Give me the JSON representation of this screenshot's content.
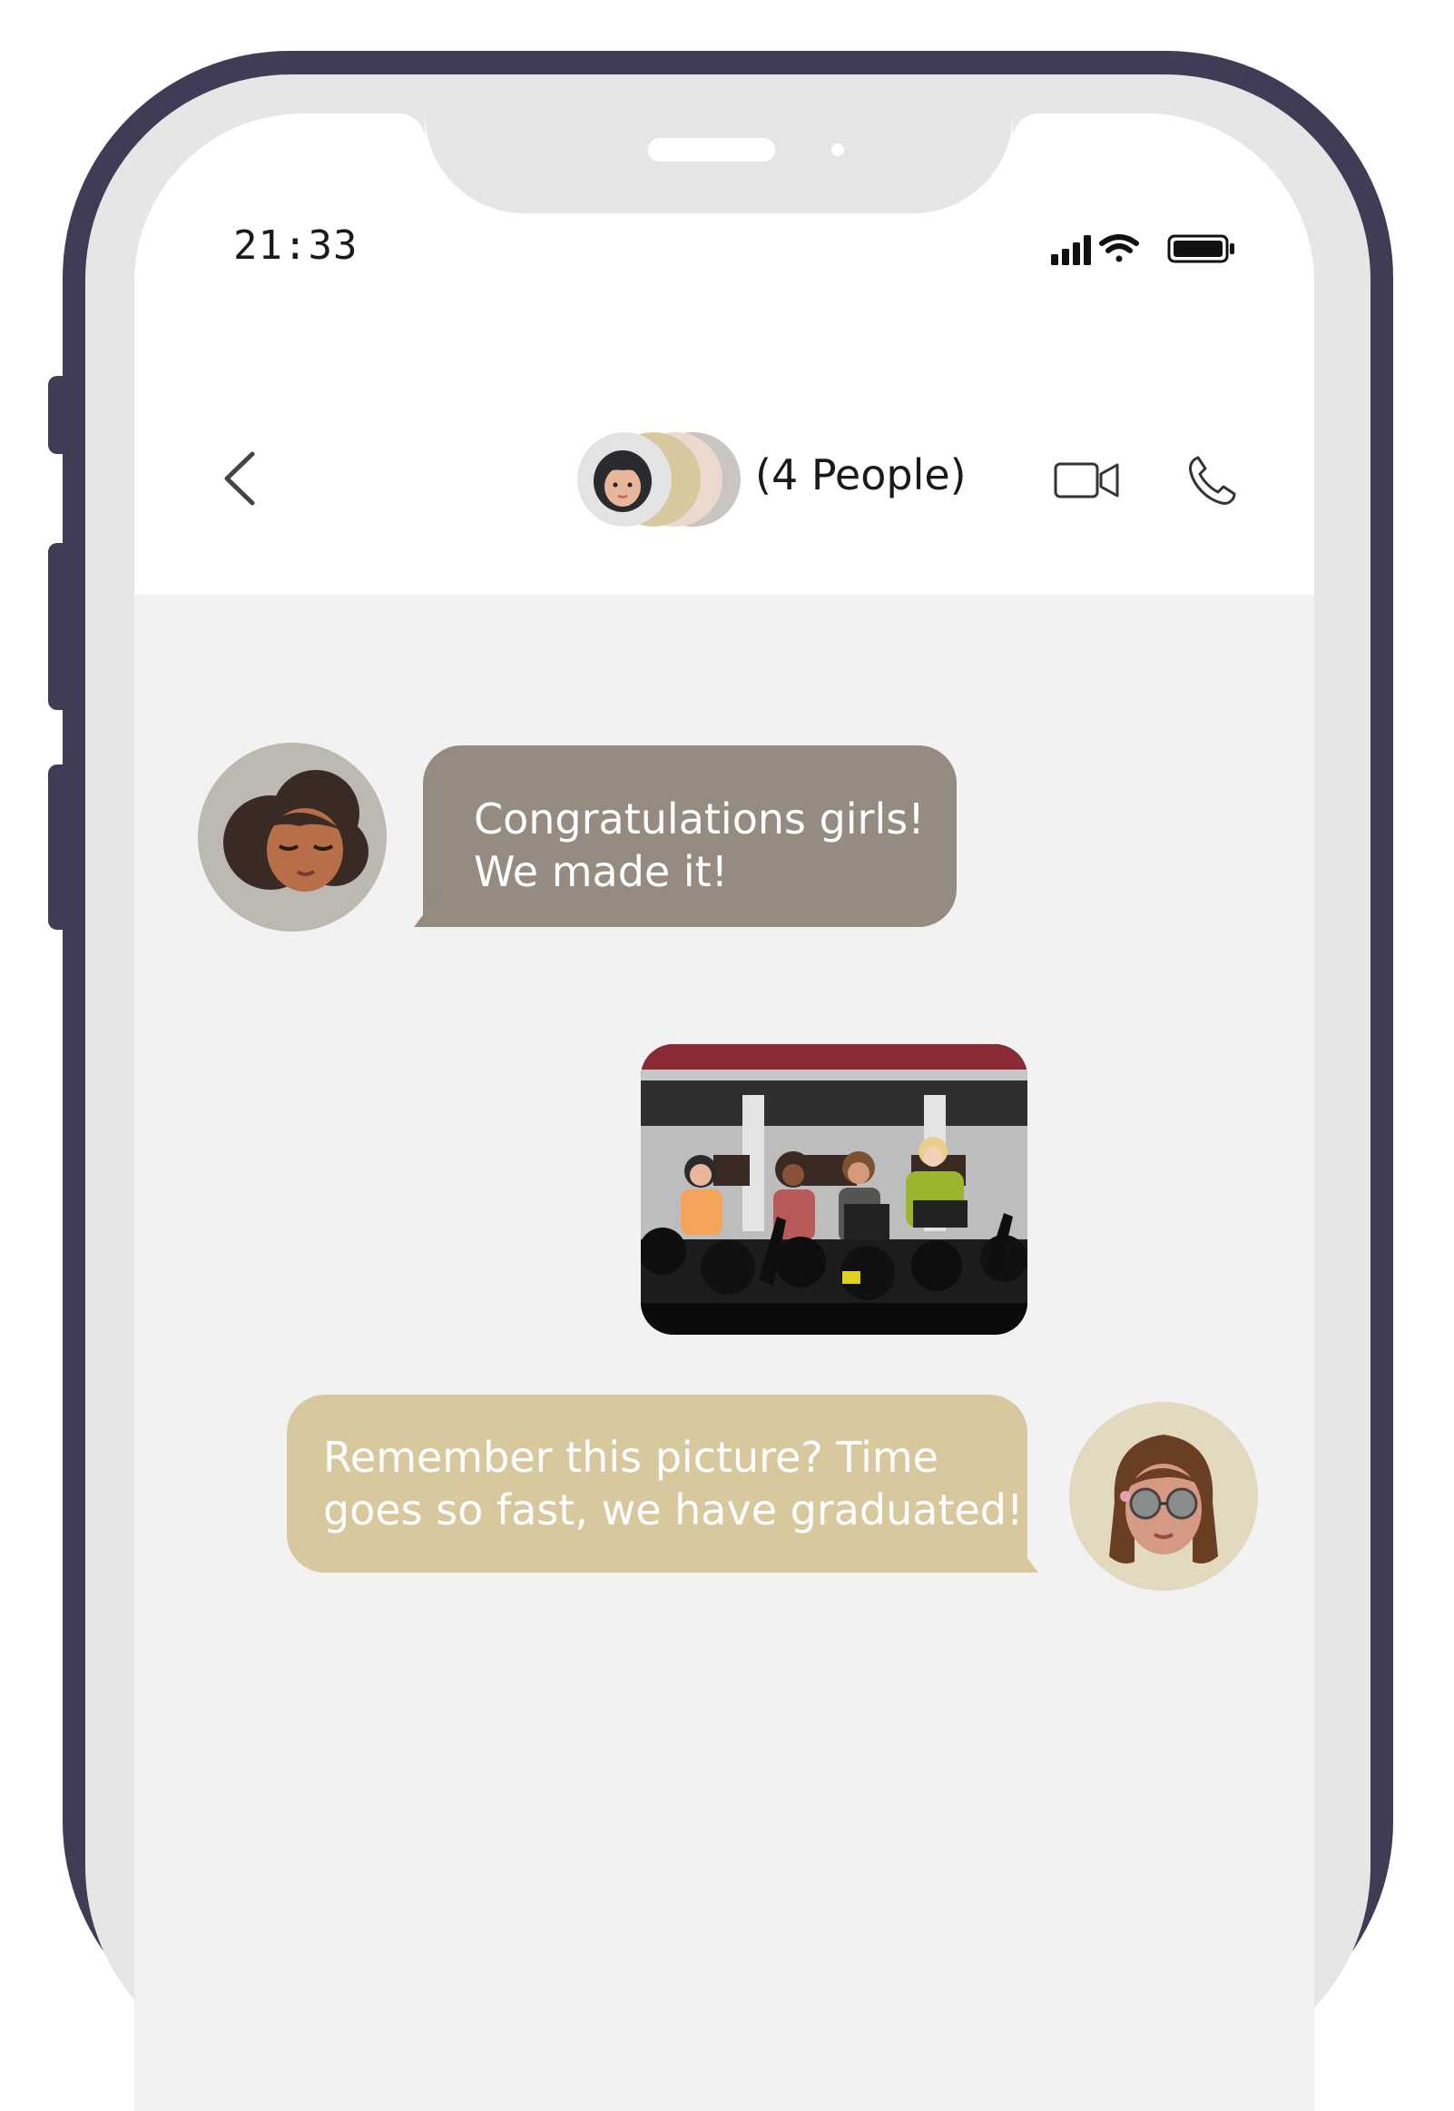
{
  "status_bar": {
    "time": "21:33",
    "icons": [
      "cellular-signal-icon",
      "wifi-icon",
      "battery-icon"
    ]
  },
  "header": {
    "back_icon": "chevron-left-icon",
    "group_label": "(4 People)",
    "actions": [
      "video-camera-icon",
      "phone-icon"
    ]
  },
  "messages": [
    {
      "direction": "incoming",
      "avatar": "avatar-curly-hair-woman",
      "lines": [
        "Congratulations girls!",
        "We made it!"
      ]
    },
    {
      "direction": "outgoing",
      "type": "image",
      "content": "graduation-photo"
    },
    {
      "direction": "outgoing",
      "avatar": "avatar-glasses-woman",
      "lines": [
        "Remember this picture? Time",
        "goes so fast, we have graduated!"
      ]
    }
  ],
  "colors": {
    "frame": "#403c56",
    "bezel": "#e6e6e6",
    "chat_background": "#f2f2f2",
    "incoming_bubble": "#958b80",
    "outgoing_bubble": "#d8c89d",
    "text_on_bubble": "#ffffff"
  }
}
